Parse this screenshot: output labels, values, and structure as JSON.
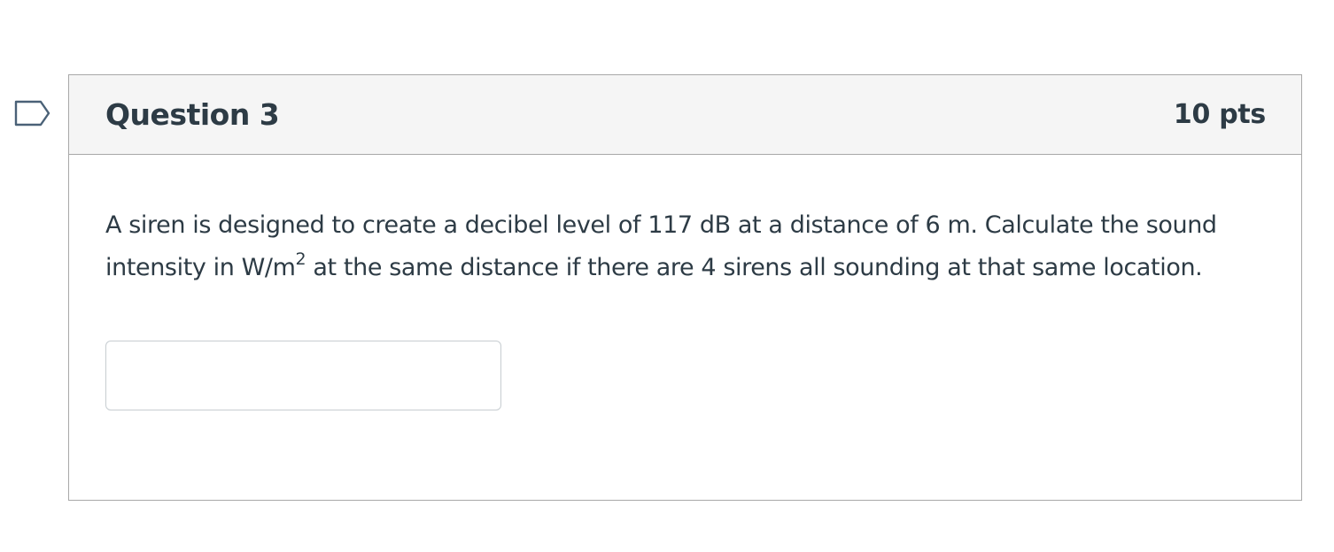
{
  "question": {
    "title": "Question 3",
    "points": "10 pts",
    "text_before_sup": "A siren is designed to create a decibel level of 117 dB at a distance of 6 m. Calculate the sound intensity in W/m",
    "superscript": "2",
    "text_after_sup": " at the same distance if there are 4 sirens all sounding at that same location.",
    "answer": {
      "value": "",
      "placeholder": ""
    }
  },
  "colors": {
    "text": "#2d3b45",
    "header_background": "#f5f5f5",
    "border": "#a8a8a8",
    "flag_stroke": "#4a6177"
  },
  "icons": {
    "flag": "flag-question-icon"
  }
}
